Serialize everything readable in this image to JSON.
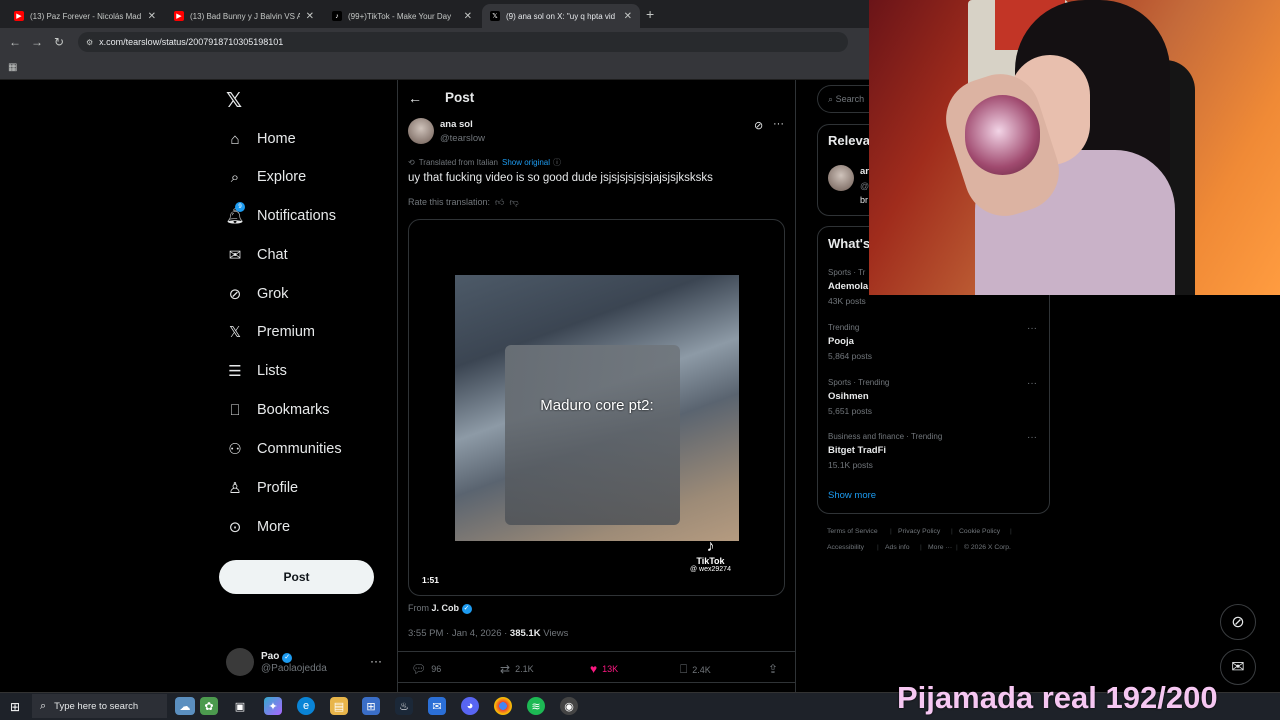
{
  "browser": {
    "tabs": [
      {
        "title": "(13) Paz Forever - Nicolás Mad",
        "favicon": "youtube-icon"
      },
      {
        "title": "(13) Bad Bunny y J Balvin VS An",
        "favicon": "youtube-icon"
      },
      {
        "title": "(99+)TikTok - Make Your Day",
        "favicon": "tiktok-icon"
      },
      {
        "title": "(9) ana sol on X: \"uy q hpta vid",
        "favicon": "x-icon"
      }
    ],
    "url": "x.com/tearslow/status/2007918710305198101"
  },
  "nav": {
    "items": [
      {
        "label": "Home",
        "icon": "home-icon"
      },
      {
        "label": "Explore",
        "icon": "search-icon"
      },
      {
        "label": "Notifications",
        "icon": "bell-icon",
        "badge": "9"
      },
      {
        "label": "Chat",
        "icon": "mail-icon"
      },
      {
        "label": "Grok",
        "icon": "grok-icon"
      },
      {
        "label": "Premium",
        "icon": "x-icon"
      },
      {
        "label": "Lists",
        "icon": "list-icon"
      },
      {
        "label": "Bookmarks",
        "icon": "bookmark-icon"
      },
      {
        "label": "Communities",
        "icon": "people-icon"
      },
      {
        "label": "Profile",
        "icon": "person-icon"
      },
      {
        "label": "More",
        "icon": "more-circle-icon"
      }
    ],
    "post_button": "Post",
    "account": {
      "name": "Pao",
      "handle": "@Paolaojedda"
    }
  },
  "post": {
    "header": "Post",
    "author": {
      "name": "ana sol",
      "handle": "@tearslow"
    },
    "translated_from": "Translated from Italian",
    "show_original": "Show original",
    "text": "uy that fucking video is so good dude jsjsjsjsjsjsjajsjsjksksks",
    "rate_translation": "Rate this translation:",
    "video": {
      "caption": "Maduro core pt2:",
      "watermark": "TikTok",
      "watermark_user": "@ wex29274",
      "duration": "1:51"
    },
    "from_label": "From",
    "from_user": "J. Cob",
    "time": "3:55 PM · Jan 4, 2026 ·",
    "views_count": "385.1K",
    "views_label": "Views",
    "actions": {
      "replies": "96",
      "reposts": "2.1K",
      "likes": "13K",
      "bookmarks": "2.4K"
    }
  },
  "sidebar": {
    "search_placeholder": "Search",
    "relevant_title": "Releva",
    "relevant_user": {
      "name": "ar",
      "handle": "@",
      "bio": "br"
    },
    "trending_title": "What's",
    "trends": [
      {
        "category": "Sports · Tr",
        "name": "Ademola",
        "posts": "43K posts"
      },
      {
        "category": "Trending",
        "name": "Pooja",
        "posts": "5,864 posts"
      },
      {
        "category": "Sports · Trending",
        "name": "Osihmen",
        "posts": "5,651 posts"
      },
      {
        "category": "Business and finance · Trending",
        "name": "Bitget TradFi",
        "posts": "15.1K posts"
      }
    ],
    "show_more": "Show more",
    "footer": [
      "Terms of Service",
      "Privacy Policy",
      "Cookie Policy",
      "Accessibility",
      "Ads info",
      "More ···",
      "© 2026 X Corp."
    ]
  },
  "stream_overlay": "Pijamada real 192/200",
  "taskbar": {
    "search_placeholder": "Type here to search"
  }
}
